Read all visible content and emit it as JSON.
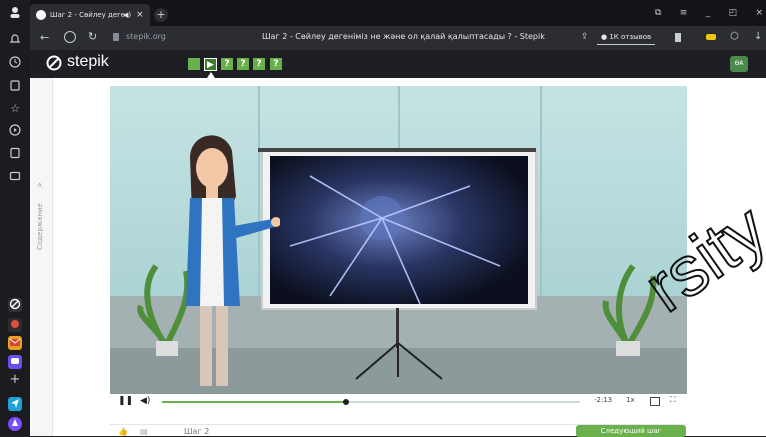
{
  "browser": {
    "tab_title": "Шаг 2 - Сөйлеу деге",
    "tab_audio": "◀)",
    "tab_close": "×",
    "new_tab": "+",
    "url": "stepik.org",
    "page_title": "Шаг 2 - Сөйлеу дегеніміз не және ол қалай қалыптасады ? - Stepik",
    "reviews_button": "1К отзывов",
    "window_controls": [
      "⧉",
      "≡",
      "_",
      "◰",
      "×"
    ]
  },
  "stepik": {
    "logo_text": "stepik",
    "steps": [
      "",
      "▶",
      "?",
      "?",
      "?",
      "?"
    ],
    "avatar": "ӨА"
  },
  "leftnav": {
    "label": "Содержание",
    "arrow": ">"
  },
  "player": {
    "time": "-2:13",
    "speed": "1x",
    "progress": 0.44
  },
  "footer": {
    "step_label": "Шаг 2",
    "next_button": "Следующий шаг"
  },
  "watermark": "rsity",
  "colors": {
    "accent": "#6ab04c",
    "header": "#1d1f24"
  }
}
